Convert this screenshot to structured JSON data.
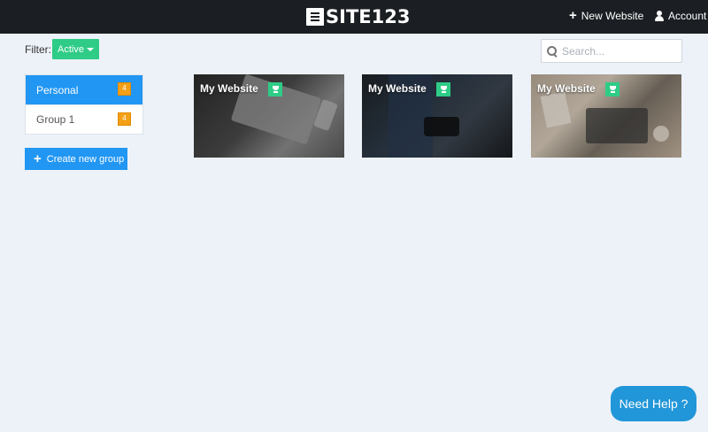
{
  "header": {
    "logo_text": "SITE123",
    "new_website_label": "New Website",
    "account_label": "Account"
  },
  "filter": {
    "label": "Filter:",
    "selected": "Active"
  },
  "search": {
    "placeholder": "Search..."
  },
  "groups": {
    "items": [
      {
        "label": "Personal",
        "count": "4",
        "active": true
      },
      {
        "label": "Group 1",
        "count": "4",
        "active": false
      }
    ],
    "create_label": "Create new group"
  },
  "websites": [
    {
      "title": "My Website",
      "plan_icon": "trophy-icon"
    },
    {
      "title": "My Website",
      "plan_icon": "trophy-icon"
    },
    {
      "title": "My Website",
      "plan_icon": "trophy-icon"
    }
  ],
  "help": {
    "label": "Need Help ?"
  },
  "colors": {
    "topbar": "#1b1f23",
    "accent_blue": "#2196f3",
    "accent_green": "#2ecc87",
    "badge_orange": "#f4a017",
    "background": "#edf2f8"
  }
}
